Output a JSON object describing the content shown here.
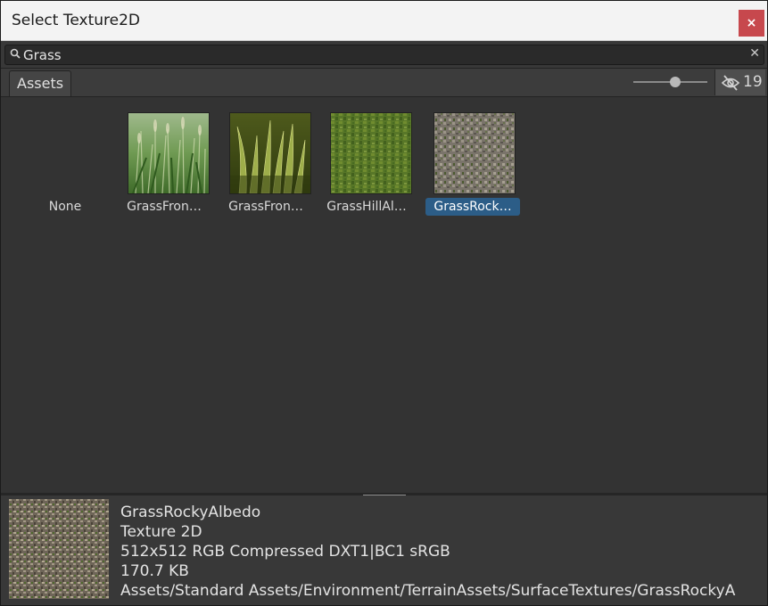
{
  "window": {
    "title": "Select Texture2D",
    "close_label": "×"
  },
  "search": {
    "value": "Grass",
    "placeholder": "",
    "clear_label": "✕"
  },
  "toolbar": {
    "tab_label": "Assets",
    "hidden_count": "19",
    "thumbnail_size_fraction": 0.58
  },
  "grid": {
    "items": [
      {
        "label": "None",
        "selected": false
      },
      {
        "label": "GrassFron…",
        "selected": false
      },
      {
        "label": "GrassFron…",
        "selected": false
      },
      {
        "label": "GrassHillAl…",
        "selected": false
      },
      {
        "label": "GrassRock…",
        "selected": true
      }
    ]
  },
  "preview": {
    "name": "GrassRockyAlbedo",
    "type": "Texture 2D",
    "format": "512x512  RGB Compressed DXT1|BC1 sRGB",
    "size": "170.7 KB",
    "path": "Assets/Standard Assets/Environment/TerrainAssets/SurfaceTextures/GrassRockyA"
  },
  "colors": {
    "selection": "#2c5d87",
    "close": "#c7484d",
    "background": "#383838"
  }
}
